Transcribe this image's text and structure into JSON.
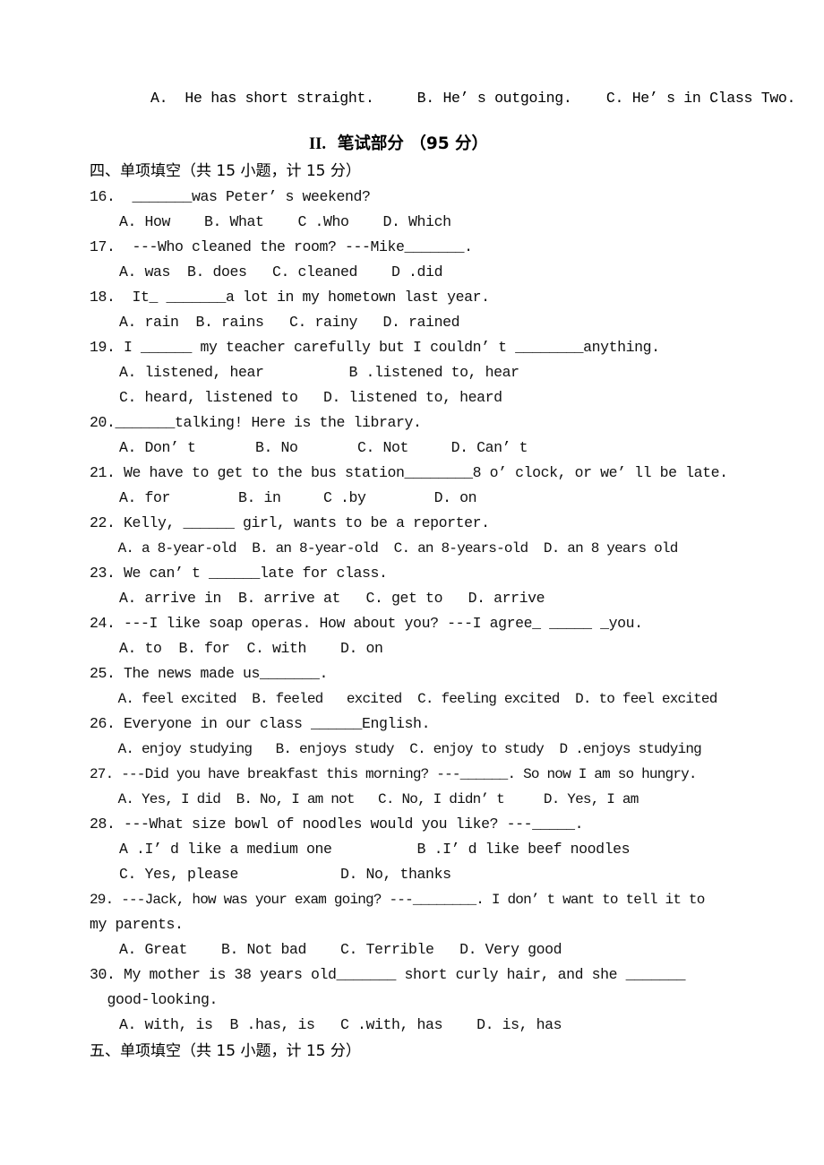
{
  "document": {
    "carry_over_choices": "A.  He has short straight.     B. He’ s outgoing.    C. He’ s in Class Two.",
    "section_title_roman": "II.",
    "section_title_cn": "笔试部分",
    "section_title_points": "（95 分）",
    "heading_four": "四、单项填空（共 15 小题，计 15 分）",
    "heading_five": "五、单项填空（共 15 小题，计 15 分）",
    "questions": [
      {
        "number": "16.",
        "stem": "16.  _______was Peter’ s weekend?",
        "option_lines": [
          "  A. How    B. What    C .Who    D. Which"
        ]
      },
      {
        "number": "17.",
        "stem": "17.  ---Who cleaned the room? ---Mike_______.",
        "option_lines": [
          "  A. was  B. does   C. cleaned    D .did"
        ]
      },
      {
        "number": "18.",
        "stem": "18.  It_ _______a lot in my hometown last year.",
        "option_lines": [
          "  A. rain  B. rains   C. rainy   D. rained"
        ]
      },
      {
        "number": "19.",
        "stem": "19. I ______ my teacher carefully but I couldn’ t ________anything.",
        "option_lines": [
          "  A. listened, hear          B .listened to, hear",
          "  C. heard, listened to   D. listened to, heard"
        ]
      },
      {
        "number": "20.",
        "stem": "20._______talking! Here is the library.",
        "option_lines": [
          "  A. Don’ t       B. No       C. Not     D. Can’ t"
        ]
      },
      {
        "number": "21.",
        "stem": "21. We have to get to the bus station________8 o’ clock, or we’ ll be late.",
        "option_lines": [
          "  A. for        B. in     C .by        D. on"
        ]
      },
      {
        "number": "22.",
        "stem": "22. Kelly, ______ girl, wants to be a reporter.",
        "option_lines": [
          "  A. a 8-year-old  B. an 8-year-old  C. an 8-years-old  D. an 8 years old"
        ]
      },
      {
        "number": "23.",
        "stem": "23. We can’ t ______late for class.",
        "option_lines": [
          "  A. arrive in  B. arrive at   C. get to   D. arrive"
        ]
      },
      {
        "number": "24.",
        "stem": "24. ---I like soap operas. How about you? ---I agree_ _____ _you.",
        "option_lines": [
          "  A. to  B. for  C. with    D. on"
        ]
      },
      {
        "number": "25.",
        "stem": "25. The news made us_______.",
        "option_lines": [
          "  A. feel excited  B. feeled   excited  C. feeling excited  D. to feel excited"
        ]
      },
      {
        "number": "26.",
        "stem": "26. Everyone in our class ______English.",
        "option_lines": [
          "  A. enjoy studying   B. enjoys study  C. enjoy to study  D .enjoys studying"
        ]
      },
      {
        "number": "27.",
        "stem": "27. ---Did you have breakfast this morning? ---______. So now I am so hungry.",
        "option_lines": [
          "  A. Yes, I did  B. No, I am not   C. No, I didn’ t     D. Yes, I am"
        ]
      },
      {
        "number": "28.",
        "stem": "28. ---What size bowl of noodles would you like? ---_____.",
        "option_lines": [
          "  A .I’ d like a medium one          B .I’ d like beef noodles",
          "  C. Yes, please            D. No, thanks"
        ]
      },
      {
        "number": "29.",
        "stem": "29. ---Jack, how was your exam going? ---________. I don’ t want to tell it to",
        "continuation": "my parents.",
        "option_lines": [
          "  A. Great    B. Not bad    C. Terrible   D. Very good"
        ]
      },
      {
        "number": "30.",
        "stem": "30. My mother is 38 years old_______ short curly hair, and she _______",
        "continuation": " good-looking.",
        "option_lines": [
          "  A. with, is  B .has, is   C .with, has    D. is, has"
        ]
      }
    ]
  }
}
